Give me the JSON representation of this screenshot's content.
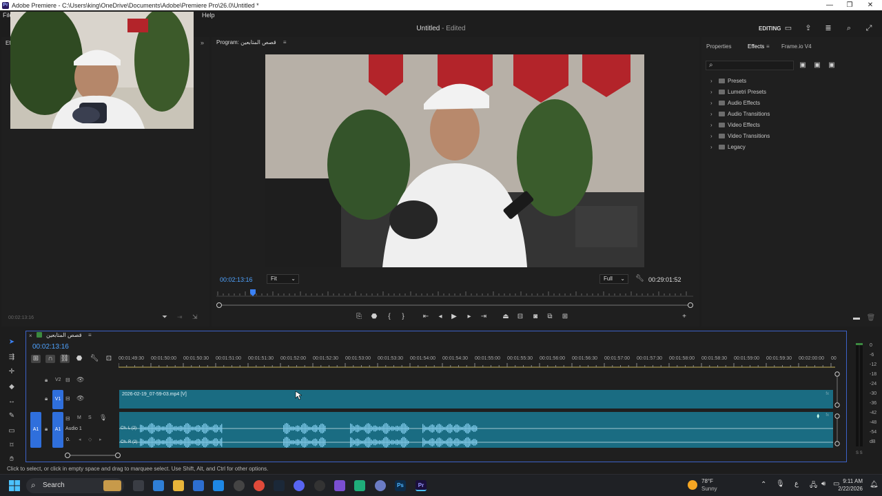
{
  "window": {
    "title": "Adobe Premiere - C:\\Users\\king\\OneDrive\\Documents\\Adobe\\Premiere Pro\\26.0\\Untitled *"
  },
  "menu": {
    "items": [
      "File",
      "Help"
    ]
  },
  "header": {
    "doc_title": "Untitled",
    "doc_status": "- Edited",
    "workspace": "EDITING"
  },
  "source_panel": {
    "tab": "Ef",
    "timecode": "00:02:13:16"
  },
  "program_monitor": {
    "title": "Program: قصص المتابعين",
    "timecode": "00:02:13:16",
    "fit": "Fit",
    "quality": "Full",
    "duration": "00:29:01:52"
  },
  "effects_panel": {
    "tabs": [
      "Properties",
      "Effects",
      "Frame.io V4"
    ],
    "search_placeholder": "",
    "folders": [
      "Presets",
      "Lumetri Presets",
      "Audio Effects",
      "Audio Transitions",
      "Video Effects",
      "Video Transitions",
      "Legacy"
    ]
  },
  "timeline": {
    "sequence_name": "قصص المتابعين",
    "timecode": "00:02:13:16",
    "ruler": [
      "00:01:49:30",
      "00:01:50:00",
      "00:01:50:30",
      "00:01:51:00",
      "00:01:51:30",
      "00:01:52:00",
      "00:01:52:30",
      "00:01:53:00",
      "00:01:53:30",
      "00:01:54:00",
      "00:01:54:30",
      "00:01:55:00",
      "00:01:55:30",
      "00:01:56:00",
      "00:01:56:30",
      "00:01:57:00",
      "00:01:57:30",
      "00:01:58:00",
      "00:01:58:30",
      "00:01:59:00",
      "00:01:59:30",
      "00:02:00:00",
      "00"
    ],
    "tracks": {
      "v2": "V2",
      "v1": "V1",
      "a1_src": "A1",
      "a1": "A1",
      "audio_name": "Audio 1",
      "audio_vol": "0.",
      "m": "M",
      "s": "S"
    },
    "video_clip": "2026-02-19_07-59-03.mp4 [V]",
    "ch_left": "Ch. L (2)",
    "ch_right": "Ch. R (2)"
  },
  "meter": {
    "labels": [
      "0",
      "-6",
      "-12",
      "-18",
      "-24",
      "-30",
      "-36",
      "-42",
      "-48",
      "-54",
      "dB"
    ],
    "footer": "S S"
  },
  "status": {
    "text": "Click to select, or click in empty space and drag to marquee select. Use Shift, Alt, and Ctrl for other options."
  },
  "taskbar": {
    "search": "Search",
    "weather_temp": "78°F",
    "weather_desc": "Sunny",
    "time": "9:11 AM",
    "date": "2/22/2026",
    "lang": "ع"
  },
  "colors": {
    "accent_blue": "#3b82f6",
    "clip_teal": "#1a6c82",
    "waveform": "#7cc8e8",
    "panel_bg": "#1f1f1f"
  }
}
